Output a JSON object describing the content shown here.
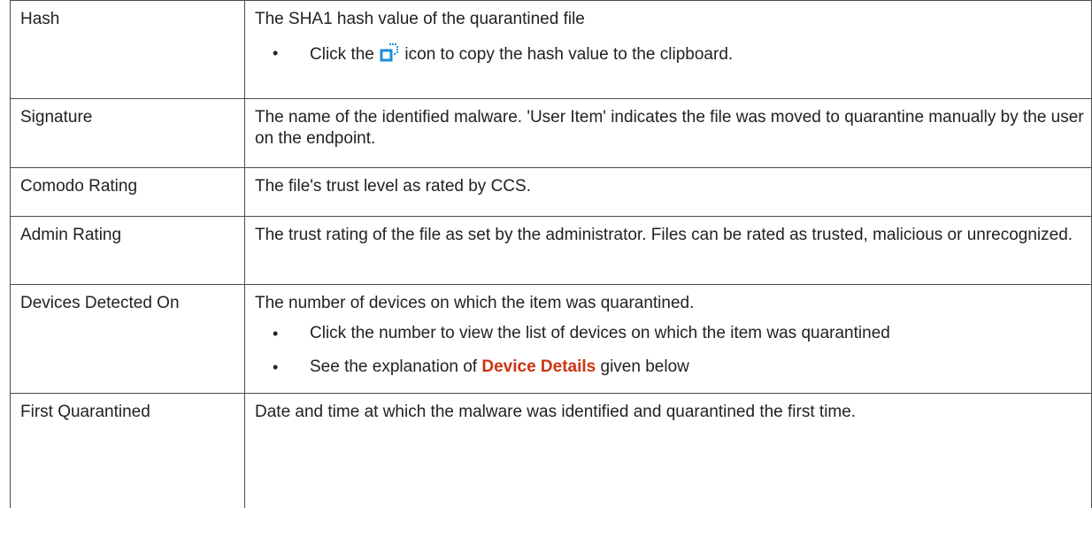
{
  "rows": [
    {
      "field": "Hash",
      "description": "The SHA1 hash value of the quarantined file",
      "bullet_before_icon": "Click the",
      "bullet_after_icon": "icon to copy the hash value to the clipboard.",
      "icon": "copy-icon"
    },
    {
      "field": "Signature",
      "description": "The name of the identified malware. 'User Item' indicates the file was moved to quarantine manually by the user on the endpoint."
    },
    {
      "field": "Comodo Rating",
      "description": "The file's trust level as rated by CCS."
    },
    {
      "field": "Admin Rating",
      "description": "The trust rating of the file as set by the administrator. Files can be rated as trusted, malicious or unrecognized."
    },
    {
      "field": "Devices Detected On",
      "description": "The number of devices on which the item was quarantined.",
      "bullet1": "Click the number to view the list of devices on which the item was quarantined",
      "bullet2_before": "See the explanation of",
      "bullet2_link": "Device Details",
      "bullet2_after": "given below"
    },
    {
      "field": "First Quarantined",
      "description": "Date and time at which the malware was identified and quarantined the first time."
    }
  ],
  "bullet_glyph": "•",
  "colors": {
    "link": "#cc3311",
    "icon": "#1a8fd8",
    "border": "#4a4a4a"
  }
}
